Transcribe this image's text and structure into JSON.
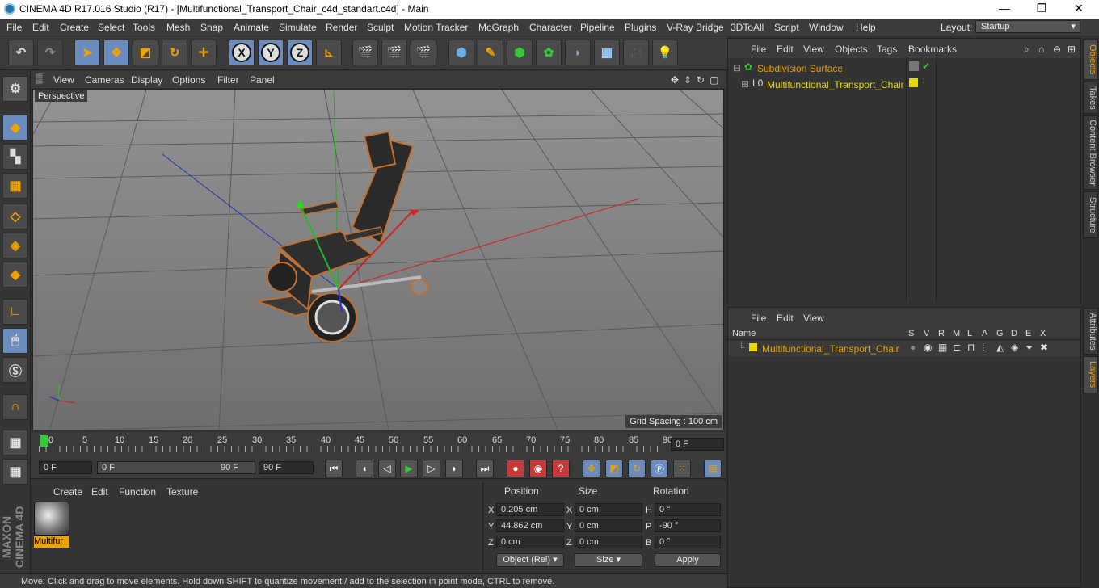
{
  "window": {
    "title": "CINEMA 4D R17.016 Studio (R17) - [Multifunctional_Transport_Chair_c4d_standart.c4d] - Main",
    "min": "—",
    "max": "❐",
    "close": "✕"
  },
  "menu": [
    "File",
    "Edit",
    "Create",
    "Select",
    "Tools",
    "Mesh",
    "Snap",
    "Animate",
    "Simulate",
    "Render",
    "Sculpt",
    "Motion Tracker",
    "MoGraph",
    "Character",
    "Pipeline",
    "Plugins",
    "V-Ray Bridge",
    "3DToAll",
    "Script",
    "Window",
    "Help"
  ],
  "layout": {
    "label": "Layout:",
    "value": "Startup"
  },
  "toolbar": {
    "x": "X",
    "y": "Y",
    "z": "Z"
  },
  "viewport": {
    "menu": [
      "View",
      "Cameras",
      "Display",
      "Options",
      "Filter",
      "Panel"
    ],
    "camera": "Perspective",
    "grid_spacing": "Grid Spacing : 100 cm"
  },
  "timeline": {
    "ticks": [
      "0",
      "5",
      "10",
      "15",
      "20",
      "25",
      "30",
      "35",
      "40",
      "45",
      "50",
      "55",
      "60",
      "65",
      "70",
      "75",
      "80",
      "85",
      "90"
    ],
    "current_frame": "0 F",
    "start": "0 F",
    "range_start": "0 F",
    "range_end": "90 F",
    "end": "90 F"
  },
  "material": {
    "menu": [
      "Create",
      "Edit",
      "Function",
      "Texture"
    ],
    "name": "Multifur"
  },
  "coords": {
    "headers": [
      "Position",
      "Size",
      "Rotation"
    ],
    "pos": [
      {
        "axis": "X",
        "value": "0.205 cm"
      },
      {
        "axis": "Y",
        "value": "44.862 cm"
      },
      {
        "axis": "Z",
        "value": "0 cm"
      }
    ],
    "size": [
      {
        "axis": "X",
        "value": "0 cm"
      },
      {
        "axis": "Y",
        "value": "0 cm"
      },
      {
        "axis": "Z",
        "value": "0 cm"
      }
    ],
    "rot": [
      {
        "axis": "H",
        "value": "0 °"
      },
      {
        "axis": "P",
        "value": "-90 °"
      },
      {
        "axis": "B",
        "value": "0 °"
      }
    ],
    "mode": "Object (Rel)",
    "size_mode": "Size",
    "apply": "Apply"
  },
  "status": "Move: Click and drag to move elements. Hold down SHIFT to quantize movement / add to the selection in point mode, CTRL to remove.",
  "maxon": "MAXON CINEMA 4D",
  "objects": {
    "menu": [
      "File",
      "Edit",
      "View",
      "Objects",
      "Tags",
      "Bookmarks"
    ],
    "items": [
      "Subdivision Surface",
      "Multifunctional_Transport_Chair"
    ]
  },
  "layers": {
    "menu": [
      "File",
      "Edit",
      "View"
    ],
    "columns": [
      "Name",
      "S",
      "V",
      "R",
      "M",
      "L",
      "A",
      "G",
      "D",
      "E",
      "X"
    ],
    "item": "Multifunctional_Transport_Chair"
  },
  "side_tabs": [
    "Objects",
    "Takes",
    "Content Browser",
    "Structure",
    "Attributes",
    "Layers"
  ],
  "colors": {
    "accent": "#f0a300",
    "selected_tool": "#6a8cbf",
    "layer_yellow": "#e8d800"
  }
}
